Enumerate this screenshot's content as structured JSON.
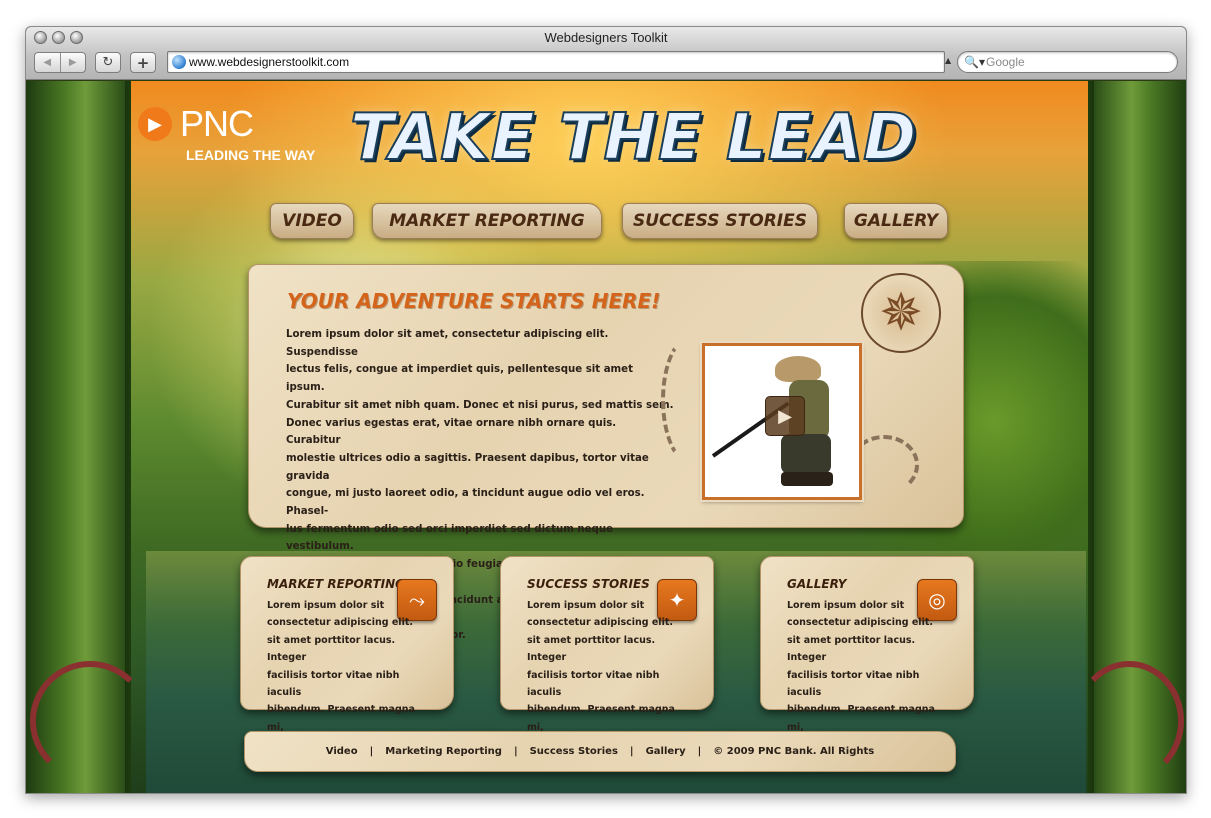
{
  "window": {
    "title": "Webdesigners Toolkit"
  },
  "toolbar": {
    "back_icon": "◀",
    "forward_icon": "▶",
    "reload_icon": "↻",
    "add_tab_icon": "+",
    "url": "www.webdesignerstoolkit.com",
    "search_placeholder": "Google",
    "search_icon": "🔍▾"
  },
  "logo": {
    "name": "PNC",
    "tagline": "LEADING THE WAY",
    "mark_icon": "▶"
  },
  "headline": "TAKE THE LEAD",
  "nav": {
    "items": [
      {
        "label": "Video"
      },
      {
        "label": "Market Reporting"
      },
      {
        "label": "Success Stories"
      },
      {
        "label": "Gallery"
      }
    ]
  },
  "main": {
    "heading": "YOUR ADVENTURE STARTS HERE!",
    "body_lines": [
      "Lorem ipsum dolor sit amet, consectetur adipiscing elit. Suspendisse",
      "lectus felis, congue at imperdiet quis, pellentesque sit amet ipsum.",
      "Curabitur sit amet nibh quam. Donec et nisi purus, sed mattis sem.",
      "Donec varius egestas erat, vitae ornare nibh ornare quis. Curabitur",
      "molestie ultrices odio a sagittis. Praesent dapibus, tortor vitae gravida",
      "congue, mi justo laoreet odio, a tincidunt augue odio vel eros. Phasel-",
      "lus fermentum odio sed orci imperdiet sed dictum neque vestibulum.",
      "Duis pellentesque urna et odio feugiat nec viverra sapien commodo.",
      "Etiam eget lorem vel justo tincidunt aliquam. Vestibulum iaculis dui sit",
      "amet tellus imperdiet porttitor."
    ],
    "compass_icon": "✵",
    "play_icon": "▶"
  },
  "cards": [
    {
      "title": "Market Reporting",
      "icon": "⤳",
      "lines": [
        "Lorem ipsum dolor sit",
        "consectetur adipiscing elit.",
        "sit amet porttitor lacus. Integer",
        "facilisis tortor vitae nibh iaculis",
        "bibendum. Praesent magna mi,"
      ]
    },
    {
      "title": "Success Stories",
      "icon": "✦",
      "lines": [
        "Lorem ipsum dolor sit",
        "consectetur adipiscing elit.",
        "sit amet porttitor lacus. Integer",
        "facilisis tortor vitae nibh iaculis",
        "bibendum. Praesent magna mi,"
      ]
    },
    {
      "title": "Gallery",
      "icon": "◎",
      "lines": [
        "Lorem ipsum dolor sit",
        "consectetur adipiscing elit.",
        "sit amet porttitor lacus. Integer",
        "facilisis tortor vitae nibh iaculis",
        "bibendum. Praesent magna mi,"
      ]
    }
  ],
  "footer": {
    "links": [
      "Video",
      "Marketing Reporting",
      "Success Stories",
      "Gallery"
    ],
    "separator": "|",
    "copyright": "© 2009 PNC Bank. All Rights"
  },
  "colors": {
    "accent_orange": "#d4641a",
    "parchment": "#e6d3b0",
    "dark_text": "#2a2018"
  }
}
